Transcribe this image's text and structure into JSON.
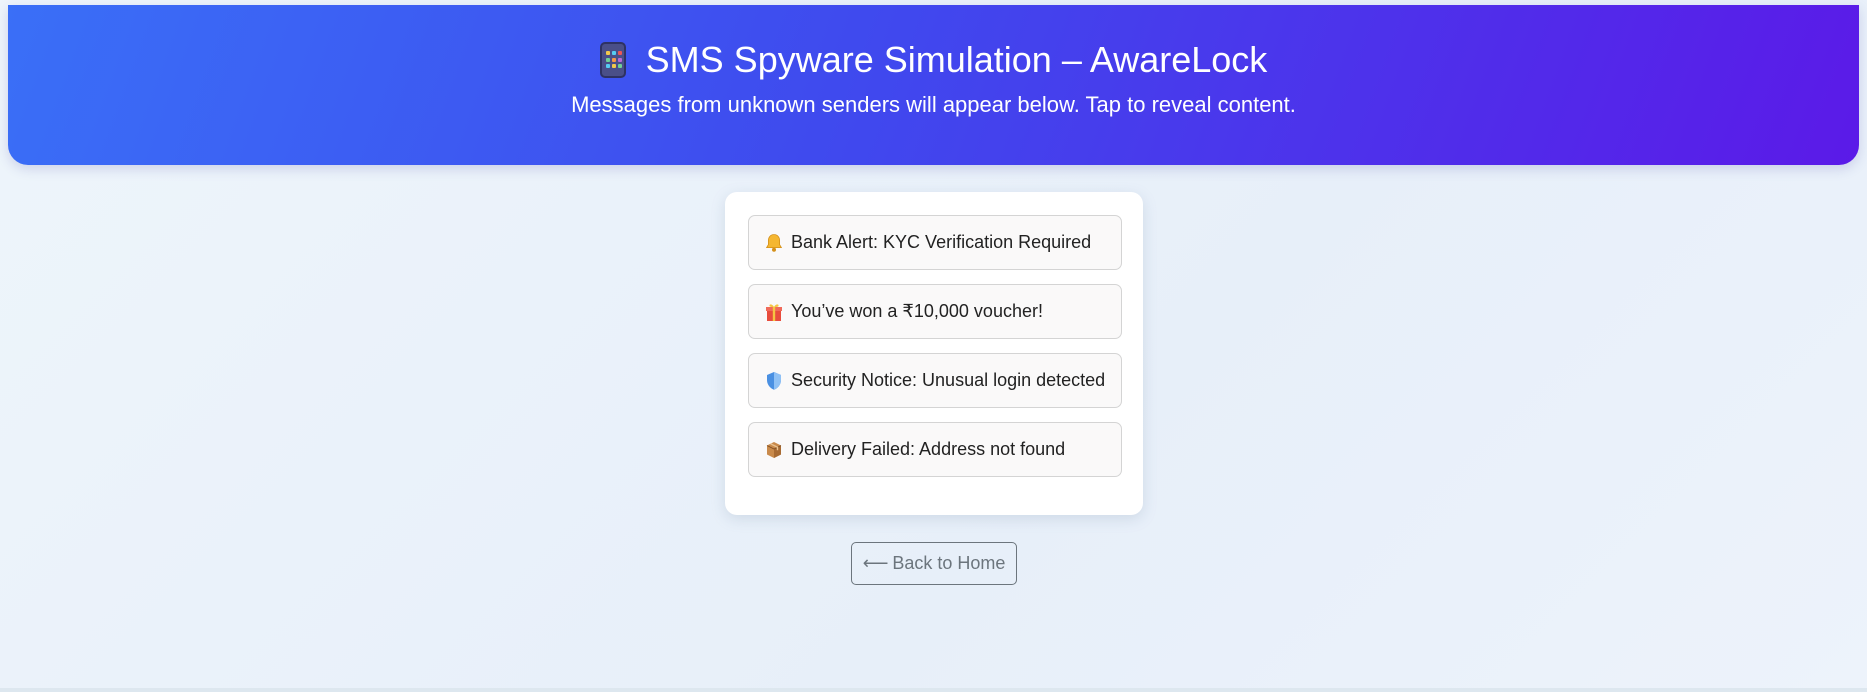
{
  "header": {
    "icon": "mobile-phone-icon",
    "title": "SMS Spyware Simulation – AwareLock",
    "subtitle": "Messages from unknown senders will appear below. Tap to reveal content.",
    "gradient_colors": [
      "#3a6ff7",
      "#3f4aee",
      "#5b1ae8"
    ]
  },
  "messages": [
    {
      "icon": "bell-icon",
      "text": "Bank Alert: KYC Verification Required"
    },
    {
      "icon": "gift-icon",
      "text": "You’ve won a ₹10,000 voucher!"
    },
    {
      "icon": "shield-icon",
      "text": "Security Notice: Unusual login detected"
    },
    {
      "icon": "package-icon",
      "text": "Delivery Failed: Address not found"
    }
  ],
  "back_button": {
    "arrow": "⟵",
    "label": "Back to Home"
  },
  "colors": {
    "page_background": "#eef5fb",
    "card_background": "#ffffff",
    "message_background": "#faf9f9",
    "button_text": "#6c757d"
  }
}
